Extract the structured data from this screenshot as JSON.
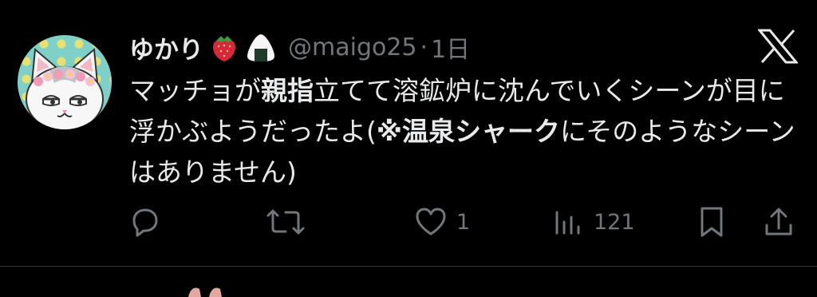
{
  "tweet": {
    "display_name": "ゆかり",
    "name_emojis": [
      "strawberry-emoji",
      "onigiri-emoji"
    ],
    "handle": "@maigo25",
    "separator": "·",
    "time": "1日",
    "logo": "x-logo-icon",
    "text_parts": [
      {
        "t": "マッチョが",
        "b": false
      },
      {
        "t": "親指",
        "b": true
      },
      {
        "t": "立てて溶鉱炉に沈んでいくシーンが目に浮かぶようだったよ(",
        "b": false
      },
      {
        "t": "※温泉シャーク",
        "b": true
      },
      {
        "t": "にそのようなシーンはありません)",
        "b": false
      }
    ],
    "actions": {
      "reply": {
        "icon": "reply-icon",
        "count": ""
      },
      "retweet": {
        "icon": "retweet-icon",
        "count": ""
      },
      "like": {
        "icon": "heart-icon",
        "count": "1"
      },
      "views": {
        "icon": "views-icon",
        "count": "121"
      },
      "bookmark": {
        "icon": "bookmark-icon"
      },
      "share": {
        "icon": "share-icon"
      }
    }
  },
  "colors": {
    "background": "#000000",
    "text": "#e7e9ea",
    "muted": "#71767b",
    "divider": "#2f3336"
  }
}
